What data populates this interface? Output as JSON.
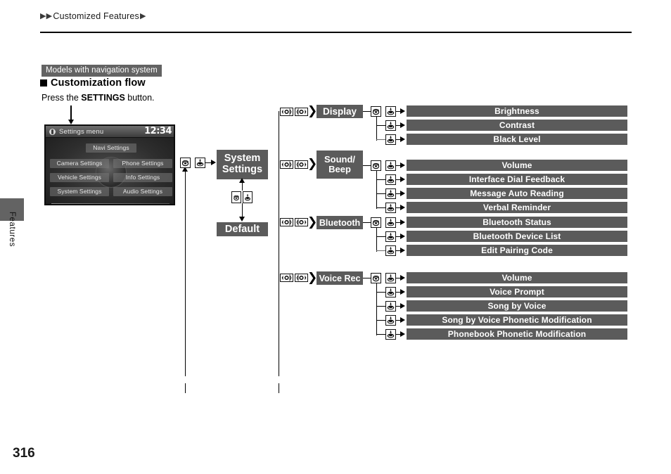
{
  "header": {
    "breadcrumb_arrow_left1": "▶",
    "breadcrumb_arrow_left2": "▶",
    "breadcrumb_text": "Customized Features",
    "breadcrumb_arrow_right": "▶"
  },
  "side_tab": {
    "label": "Features"
  },
  "page_number": "316",
  "models_badge": "Models with navigation system",
  "section_heading": "Customization flow",
  "instruction": {
    "prefix": "Press the ",
    "bold": "SETTINGS",
    "suffix": " button."
  },
  "nav_screen": {
    "title": "Settings menu",
    "clock": "12:34",
    "buttons": [
      "Navi Settings",
      "Camera Settings",
      "Phone Settings",
      "Vehicle Settings",
      "Info Settings",
      "System Settings",
      "Audio Settings"
    ]
  },
  "flow": {
    "node_system_settings": "System Settings",
    "node_system_settings_line1": "System",
    "node_system_settings_line2": "Settings",
    "node_default": "Default",
    "categories": [
      {
        "id": "display",
        "label": "Display",
        "label_line1": "Display",
        "label_line2": "",
        "items": [
          "Brightness",
          "Contrast",
          "Black Level"
        ]
      },
      {
        "id": "sound-beep",
        "label": "Sound/ Beep",
        "label_line1": "Sound/",
        "label_line2": "Beep",
        "items": [
          "Volume",
          "Interface Dial Feedback",
          "Message Auto Reading",
          "Verbal Reminder"
        ]
      },
      {
        "id": "bluetooth",
        "label": "Bluetooth",
        "label_line1": "Bluetooth",
        "label_line2": "",
        "items": [
          "Bluetooth Status",
          "Bluetooth Device List",
          "Edit Pairing Code"
        ]
      },
      {
        "id": "voice-rec",
        "label": "Voice Rec",
        "label_line1": "Voice Rec",
        "label_line2": "",
        "items": [
          "Volume",
          "Voice Prompt",
          "Song by Voice",
          "Song by Voice Phonetic Modification",
          "Phonebook Phonetic Modification"
        ]
      }
    ],
    "icons": {
      "dial_rotate": "interface-dial-rotate-icon",
      "dial_press": "interface-dial-press-icon",
      "dial_left": "interface-dial-left-icon",
      "dial_right": "interface-dial-right-icon",
      "back_button": "back-button-icon"
    }
  },
  "colors": {
    "box_gray": "#5b5b5b",
    "badge_gray": "#636363",
    "text_black": "#000000"
  }
}
